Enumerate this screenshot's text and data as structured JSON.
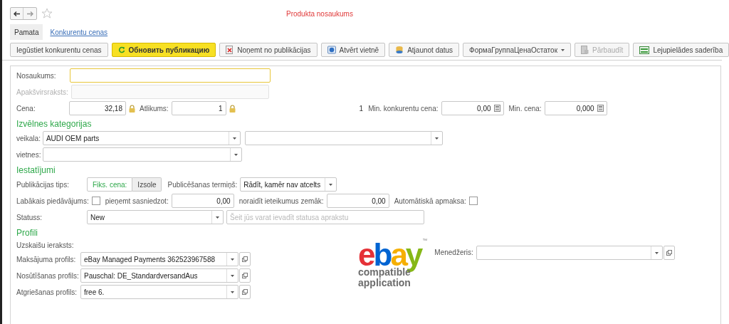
{
  "window": {
    "title": "Produkta nosaukums"
  },
  "tabs": [
    {
      "label": "Pamata",
      "selected": true
    },
    {
      "label": "Konkurentu cenas",
      "selected": false
    }
  ],
  "toolbar": [
    {
      "label": "Iegūstiet konkurentu cenas",
      "kind": "button",
      "default": false,
      "disabled": false
    },
    {
      "label": "Обновить публикацию",
      "kind": "button",
      "default": true,
      "disabled": false
    },
    {
      "label": "Noņemt no publikācijas",
      "kind": "button",
      "default": false,
      "disabled": false
    },
    {
      "label": "Atvērt vietnē",
      "kind": "button",
      "default": false,
      "disabled": false
    },
    {
      "label": "Atjaunot datus",
      "kind": "button",
      "default": false,
      "disabled": false
    },
    {
      "label": "ФормаГруппаЦенаОстаток",
      "kind": "menu",
      "default": false,
      "disabled": false
    },
    {
      "label": "Pārbaudīt",
      "kind": "button",
      "default": false,
      "disabled": true
    },
    {
      "label": "Lejupielādes saderība",
      "kind": "button",
      "default": false,
      "disabled": false
    }
  ],
  "name": {
    "label": "Nosaukums:",
    "focused": true
  },
  "subtitle": {
    "label": "Apakšvirsraksts:",
    "disabled": true
  },
  "price": {
    "label": "Cena:",
    "value": "32,18"
  },
  "stock": {
    "label": "Atlikums:",
    "value": "1"
  },
  "competitor_count": "1",
  "min_competitor_price": {
    "label": "Min. konkurentu cena:",
    "value": "0,00"
  },
  "min_price": {
    "label": "Min. cena:",
    "value": "0,000"
  },
  "categories": {
    "heading": "Izvēlnes kategorijas",
    "store_label": "veikala:",
    "store_value": "AUDI OEM parts",
    "site_label": "vietnes:"
  },
  "settings": {
    "heading": "Iestatījumi",
    "publication_type": {
      "label": "Publikācijas tips:",
      "options": [
        {
          "label": "Fiks. cena:",
          "selected": true
        },
        {
          "label": "Izsole",
          "selected": false
        }
      ]
    },
    "duration": {
      "label": "Publicēšanas termiņš:",
      "value": "Rādīt, kamēr nav atcelts"
    },
    "best_offer": {
      "label": "Labākais piedāvājums:",
      "checked": false
    },
    "accept": {
      "label": "pieņemt sasniedzot:",
      "value": "0,00"
    },
    "decline": {
      "label": "noraidīt ieteikumus zemāk:",
      "value": "0,00"
    },
    "auto_pay": {
      "label": "Automātiskā apmaksa:",
      "checked": false
    },
    "status": {
      "label": "Statuss:",
      "value": "New",
      "placeholder": "Šeit jūs varat ievadīt statusa aprakstu"
    }
  },
  "profiles": {
    "heading": "Profili",
    "account_label": "Uzskaišu ieraksts:",
    "items": [
      {
        "label": "Maksājuma profils:",
        "value": "eBay Managed Payments 362523967588"
      },
      {
        "label": "Nosūtīšanas profils:",
        "value": "Pauschal: DE_StandardversandAus"
      },
      {
        "label": "Atgriešanas profils:",
        "value": "free 6."
      }
    ]
  },
  "logo": {
    "letters": [
      {
        "text": "e",
        "color": "#e53238"
      },
      {
        "text": "b",
        "color": "#0064d2"
      },
      {
        "text": "a",
        "color": "#f5af02"
      },
      {
        "text": "y",
        "color": "#86b817"
      }
    ],
    "tm": "™",
    "lines": [
      "compatible",
      "application"
    ]
  },
  "manager": {
    "label": "Menedžeris:"
  }
}
